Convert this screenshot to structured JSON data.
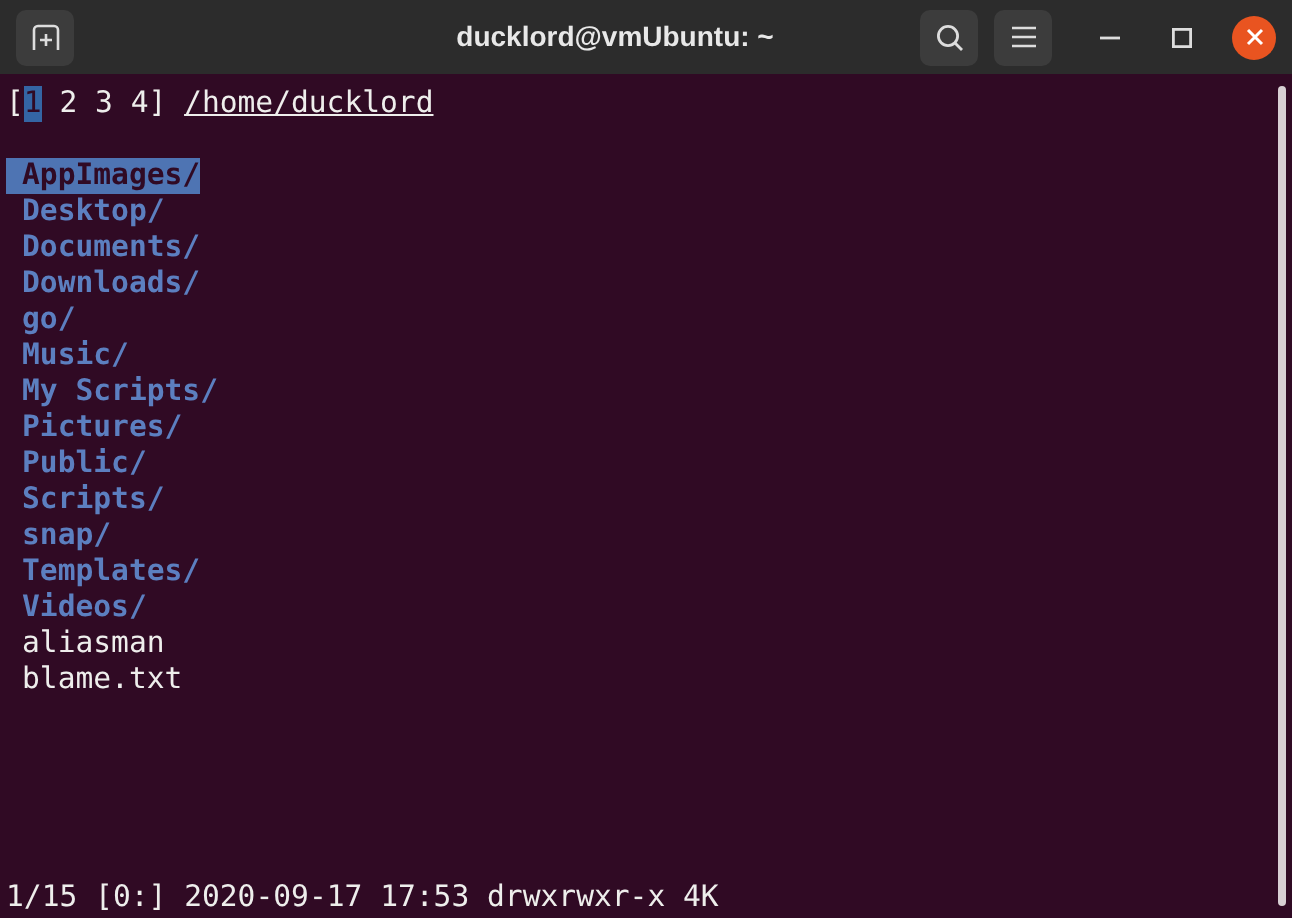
{
  "window": {
    "title": "ducklord@vmUbuntu: ~"
  },
  "tabs": [
    {
      "label": "1",
      "selected": true
    },
    {
      "label": "2",
      "selected": false
    },
    {
      "label": "3",
      "selected": false
    },
    {
      "label": "4",
      "selected": false
    }
  ],
  "tab_brackets": [
    "[",
    "]"
  ],
  "path": "/home/ducklord",
  "entries": [
    {
      "name": "AppImages/",
      "kind": "dir",
      "selected": true
    },
    {
      "name": "Desktop/",
      "kind": "dir",
      "selected": false
    },
    {
      "name": "Documents/",
      "kind": "dir",
      "selected": false
    },
    {
      "name": "Downloads/",
      "kind": "dir",
      "selected": false
    },
    {
      "name": "go/",
      "kind": "dir",
      "selected": false
    },
    {
      "name": "Music/",
      "kind": "dir",
      "selected": false
    },
    {
      "name": "My Scripts/",
      "kind": "dir",
      "selected": false
    },
    {
      "name": "Pictures/",
      "kind": "dir",
      "selected": false
    },
    {
      "name": "Public/",
      "kind": "dir",
      "selected": false
    },
    {
      "name": "Scripts/",
      "kind": "dir",
      "selected": false
    },
    {
      "name": "snap/",
      "kind": "dir",
      "selected": false
    },
    {
      "name": "Templates/",
      "kind": "dir",
      "selected": false
    },
    {
      "name": "Videos/",
      "kind": "dir",
      "selected": false
    },
    {
      "name": "aliasman",
      "kind": "file",
      "selected": false
    },
    {
      "name": "blame.txt",
      "kind": "file",
      "selected": false
    }
  ],
  "status_bar": "1/15 [0:] 2020-09-17 17:53 drwxrwxr-x 4K"
}
